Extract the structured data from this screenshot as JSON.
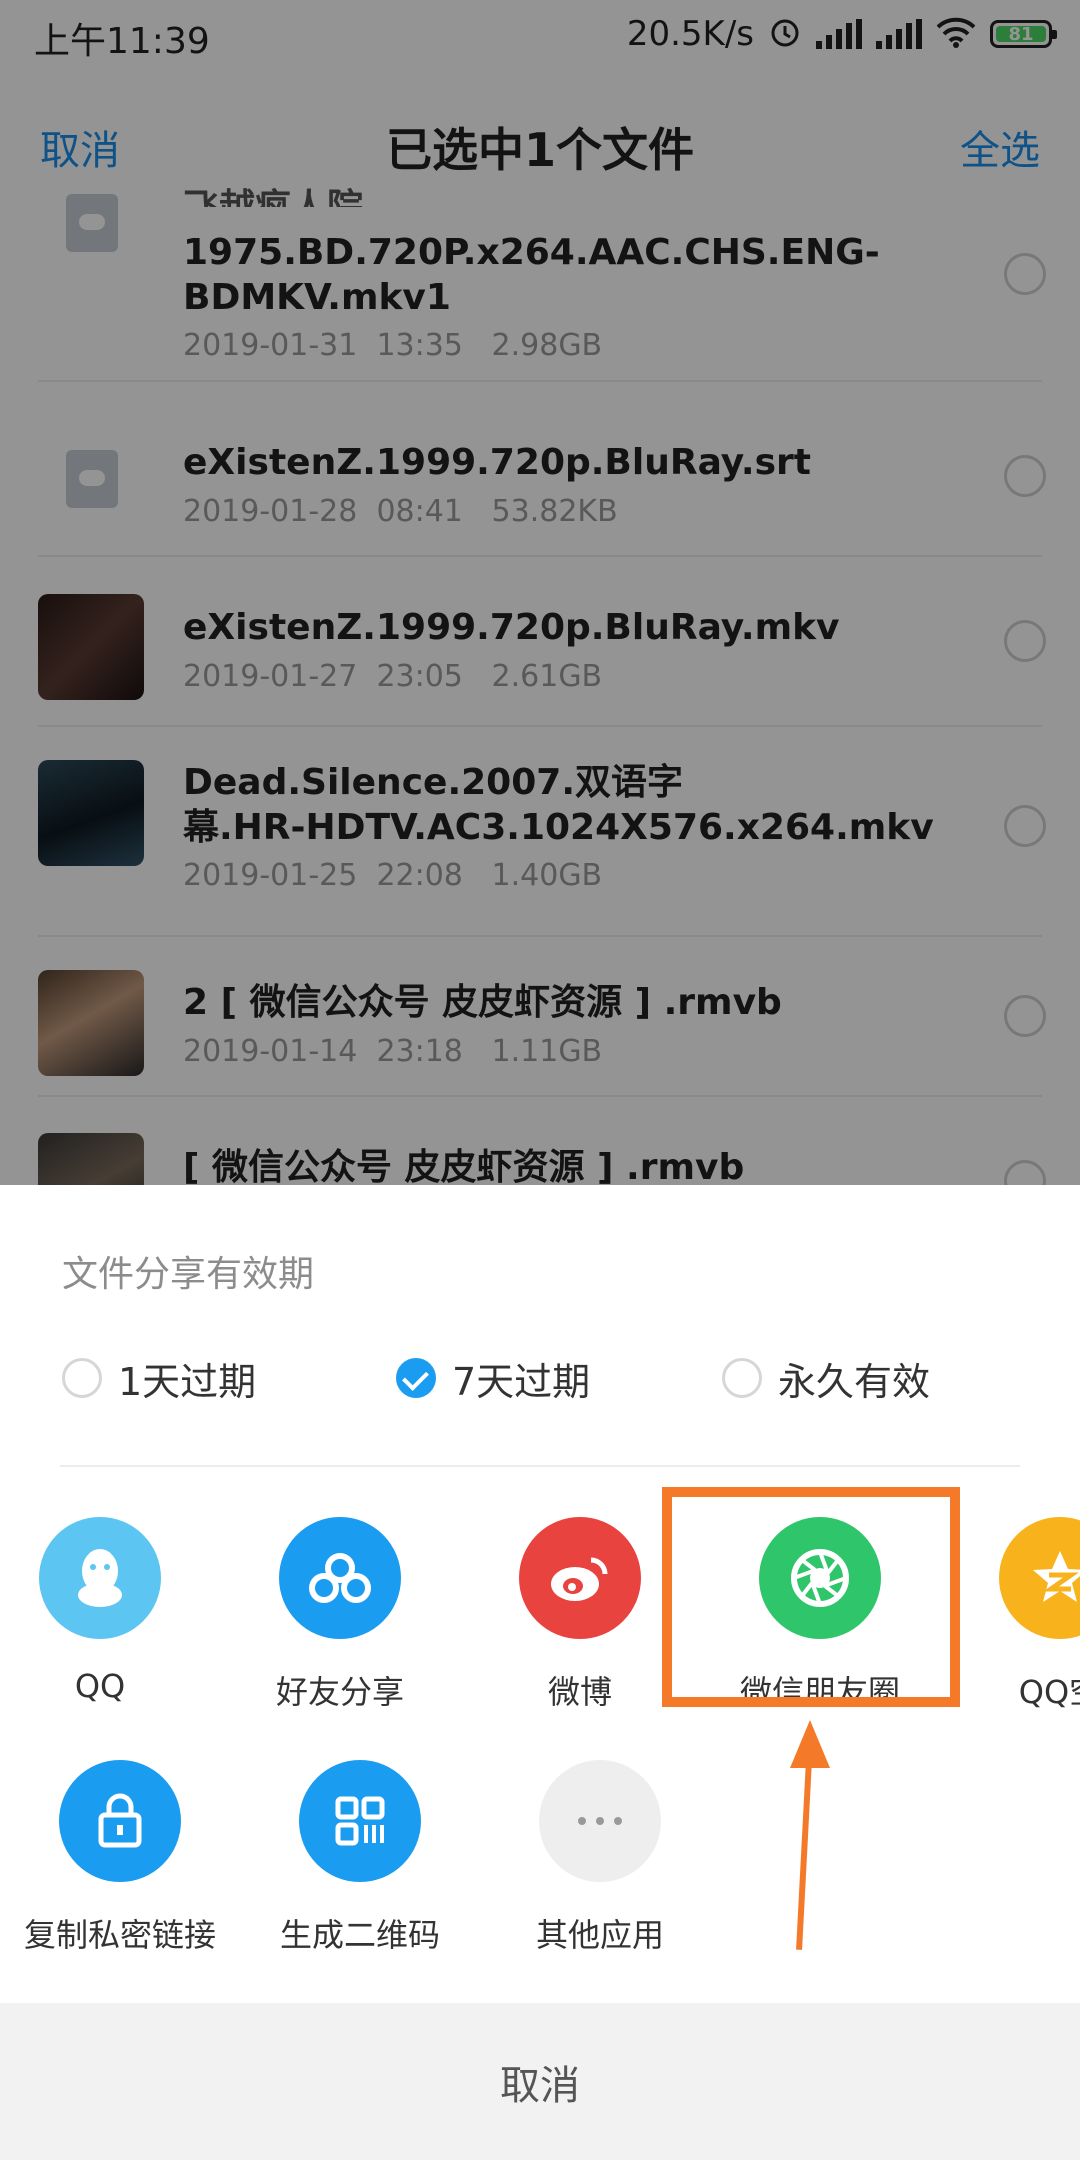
{
  "status_bar": {
    "time": "上午11:39",
    "net_speed": "20.5K/s",
    "battery": "81",
    "icons": [
      "alarm-icon",
      "signal-icon",
      "hd-signal-icon",
      "wifi-icon",
      "battery-icon"
    ]
  },
  "header": {
    "cancel": "取消",
    "title": "已选中1个文件",
    "select_all": "全选"
  },
  "files": [
    {
      "name_partial": "飞越疯人院One.Flew.Over.the.Cuckoos.Nest.",
      "name": "1975.BD.720P.x264.AAC.CHS.ENG-",
      "name2": "BDMKV.mkv1",
      "date": "2019-01-31",
      "time": "13:35",
      "size": "2.98GB",
      "icon": "cloud-file-icon"
    },
    {
      "name": "eXistenZ.1999.720p.BluRay.srt",
      "date": "2019-01-28",
      "time": "08:41",
      "size": "53.82KB",
      "icon": "cloud-file-icon"
    },
    {
      "name": "eXistenZ.1999.720p.BluRay.mkv",
      "date": "2019-01-27",
      "time": "23:05",
      "size": "2.61GB",
      "icon": "video-thumbnail"
    },
    {
      "name": "Dead.Silence.2007.双语字",
      "name2": "幕.HR-HDTV.AC3.1024X576.x264.mkv",
      "date": "2019-01-25",
      "time": "22:08",
      "size": "1.40GB",
      "icon": "video-thumbnail"
    },
    {
      "name": "2 [ 微信公众号 皮皮虾资源 ] .rmvb",
      "date": "2019-01-14",
      "time": "23:18",
      "size": "1.11GB",
      "icon": "video-thumbnail"
    },
    {
      "name": "[ 微信公众号 皮皮虾资源 ] .rmvb",
      "icon": "video-thumbnail"
    }
  ],
  "share_sheet": {
    "title": "文件分享有效期",
    "expiry_options": [
      {
        "label": "1天过期",
        "selected": false
      },
      {
        "label": "7天过期",
        "selected": true
      },
      {
        "label": "永久有效",
        "selected": false
      }
    ],
    "apps_row1": [
      {
        "label": "QQ",
        "icon": "qq-icon",
        "color": "#5cc5f2"
      },
      {
        "label": "好友分享",
        "icon": "friend-share-icon",
        "color": "#1a9cf0"
      },
      {
        "label": "微博",
        "icon": "weibo-icon",
        "color": "#e8433f"
      },
      {
        "label": "微信朋友圈",
        "icon": "wechat-moments-icon",
        "color": "#2fc56a"
      },
      {
        "label": "QQ空",
        "icon": "qzone-icon",
        "color": "#f8b21b"
      }
    ],
    "apps_row2": [
      {
        "label": "复制私密链接",
        "icon": "lock-icon",
        "color": "#1a9cf0"
      },
      {
        "label": "生成二维码",
        "icon": "qrcode-icon",
        "color": "#1a9cf0"
      },
      {
        "label": "其他应用",
        "icon": "more-icon",
        "color": "#eeeeee"
      }
    ],
    "cancel": "取消"
  },
  "annotation": {
    "color": "#f47a2a"
  }
}
